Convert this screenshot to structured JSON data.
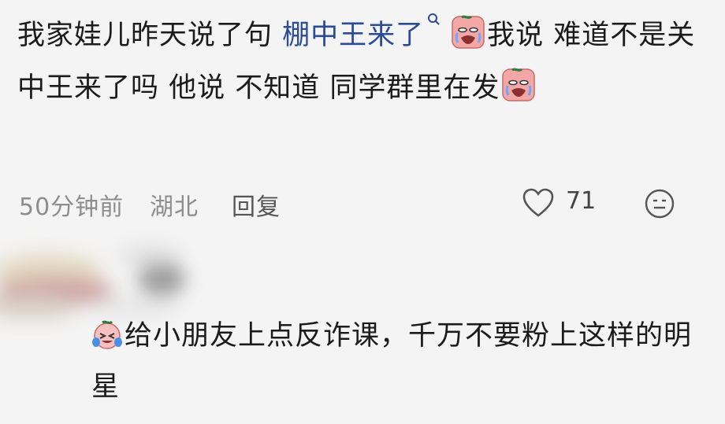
{
  "comment": {
    "part1": "我家娃儿昨天说了句",
    "link_text": "棚中王来了",
    "part2": "我说 难道不是关中王来了吗 他说 不知道 同学群里在发"
  },
  "meta": {
    "time": "50分钟前",
    "location": "湖北",
    "reply_label": "回复",
    "like_count": "71"
  },
  "reply": {
    "text": "给小朋友上点反诈课，千万不要粉上这样的明星"
  },
  "icons": {
    "link_search": "search-icon",
    "emoji_crying": "crying-face-icon",
    "emoji_laugh_cry": "laugh-cry-face-icon",
    "like": "heart-icon",
    "emoji_reply": "face-icon"
  },
  "colors": {
    "link": "#2b4c94",
    "meta": "#8d8d8d",
    "text": "#1b1b1b"
  }
}
